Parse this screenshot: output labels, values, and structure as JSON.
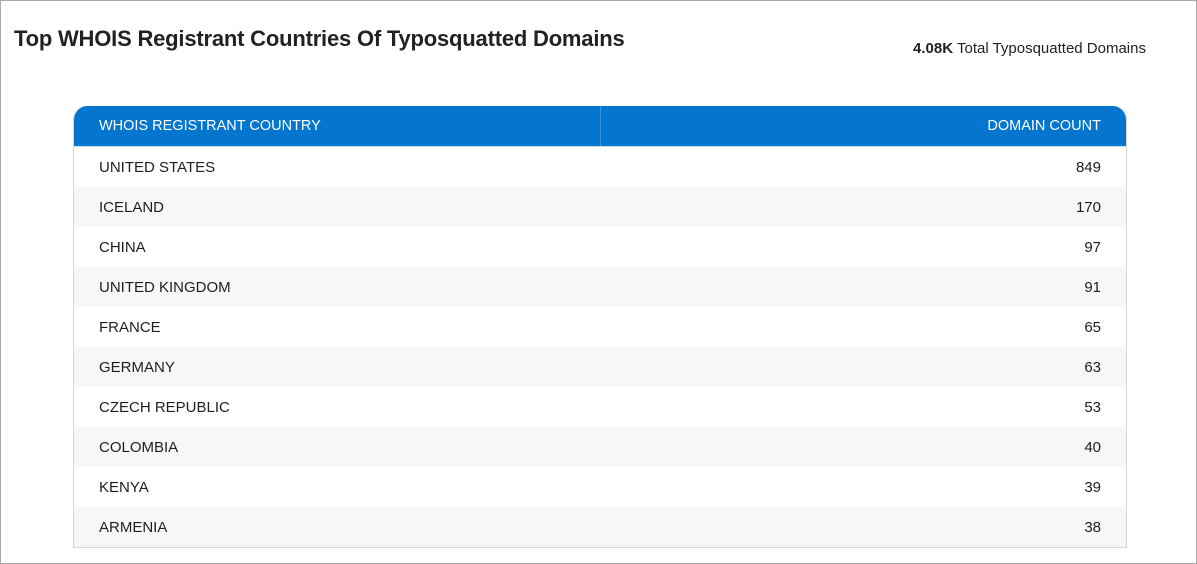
{
  "header": {
    "title": "Top WHOIS Registrant Countries Of Typosquatted Domains",
    "total_value": "4.08K",
    "total_label": "Total Typosquatted Domains"
  },
  "table": {
    "columns": [
      "WHOIS REGISTRANT COUNTRY",
      "DOMAIN COUNT"
    ],
    "rows": [
      {
        "country": "UNITED STATES",
        "count": "849"
      },
      {
        "country": "ICELAND",
        "count": "170"
      },
      {
        "country": "CHINA",
        "count": "97"
      },
      {
        "country": "UNITED KINGDOM",
        "count": "91"
      },
      {
        "country": "FRANCE",
        "count": "65"
      },
      {
        "country": "GERMANY",
        "count": "63"
      },
      {
        "country": "CZECH REPUBLIC",
        "count": "53"
      },
      {
        "country": "COLOMBIA",
        "count": "40"
      },
      {
        "country": "KENYA",
        "count": "39"
      },
      {
        "country": "ARMENIA",
        "count": "38"
      }
    ]
  },
  "colors": {
    "header_background": "#0476d0",
    "header_text": "#ffffff",
    "row_stripe": "#f6f7f9"
  }
}
